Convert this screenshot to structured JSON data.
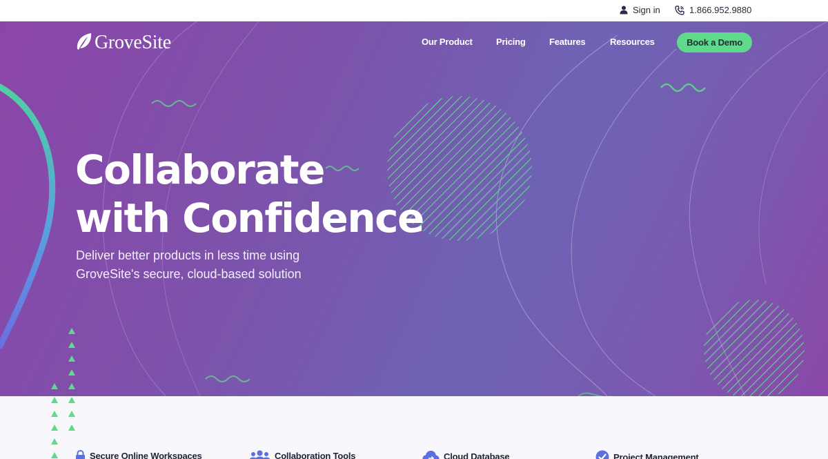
{
  "topbar": {
    "signin_label": "Sign in",
    "phone_label": "1.866.952.9880"
  },
  "header": {
    "logo_text": "GroveSite",
    "nav": {
      "our_product": "Our Product",
      "pricing": "Pricing",
      "features": "Features",
      "resources": "Resources"
    },
    "cta_label": "Book a Demo"
  },
  "hero": {
    "title_line1": "Collaborate",
    "title_line2": "with Confidence",
    "subtitle_line1": "Deliver better products in less time using",
    "subtitle_line2": "GroveSite's secure, cloud-based solution"
  },
  "features": {
    "item1": {
      "label": "Secure Online Workspaces",
      "icon": "lock-icon"
    },
    "item2": {
      "label": "Collaboration Tools",
      "icon": "team-icon"
    },
    "item3": {
      "label": "Cloud Database",
      "icon": "cloud-icon"
    },
    "item4": {
      "label": "Project Management",
      "icon": "check-circle-icon"
    }
  },
  "colors": {
    "accent_green": "#5fd98a",
    "hero_purple": "#8b45a8",
    "hero_violet": "#6e63b4",
    "feature_icon_blue": "#5a6fe0"
  }
}
